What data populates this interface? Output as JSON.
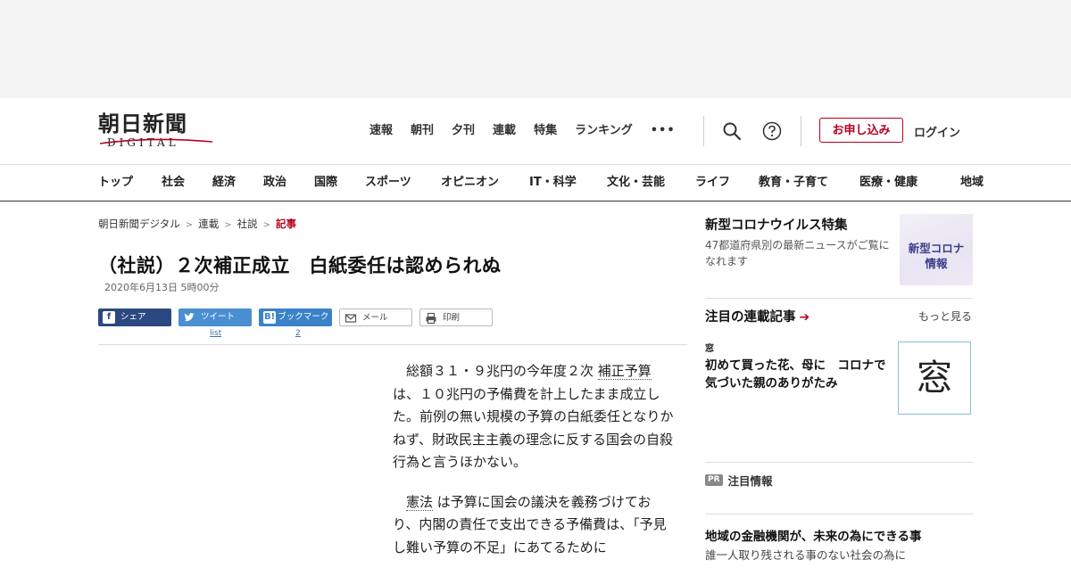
{
  "logo": {
    "main": "朝日新聞",
    "sub": "DIGITAL"
  },
  "topnav": [
    "速報",
    "朝刊",
    "夕刊",
    "連載",
    "特集",
    "ランキング"
  ],
  "more_dots": "•••",
  "header": {
    "apply": "お申し込み",
    "login": "ログイン"
  },
  "icons": {
    "search": "search-icon",
    "help": "question-circle-icon"
  },
  "catnav": [
    {
      "label": "トップ",
      "gap": 0
    },
    {
      "label": "社会"
    },
    {
      "label": "経済"
    },
    {
      "label": "政治"
    },
    {
      "label": "国際"
    },
    {
      "label": "スポーツ"
    },
    {
      "label": "オピニオン"
    },
    {
      "label": "IT・科学"
    },
    {
      "label": "文化・芸能"
    },
    {
      "label": "ライフ"
    },
    {
      "label": "教育・子育て"
    },
    {
      "label": "医療・健康"
    },
    {
      "label": "地域"
    }
  ],
  "breadcrumb": {
    "items": [
      "朝日新聞デジタル",
      "連載",
      "社説"
    ],
    "current": "記事"
  },
  "article": {
    "title": "（社説）２次補正成立　白紙委任は認められぬ",
    "date": "2020年6月13日 5時00分",
    "paragraphs": [
      {
        "pre": "総額３１・９兆円の今年度２次 ",
        "kw": "補正予算",
        "post": " は、１０兆円の予備費を計上したまま成立した。前例の無い規模の予算の白紙委任となりかねず、財政民主主義の理念に反する国会の自殺行為と言うほかない。"
      },
      {
        "pre": "",
        "kw": "憲法",
        "post": " は予算に国会の議決を義務づけており、内閣の責任で支出できる予備費は、「予見し難い予算の不足」にあてるために"
      }
    ]
  },
  "share": {
    "facebook": "シェア",
    "twitter": "ツイート",
    "hatena": "ブックマーク",
    "mail": "メール",
    "print": "印刷",
    "twitter_count": "list",
    "hatena_count": "2"
  },
  "sidebar": {
    "covid": {
      "title": "新型コロナウイルス特集",
      "desc": "47都道府県別の最新ニュースがご覧になれます",
      "thumb_line1": "新型コロナ",
      "thumb_line2": "情報"
    },
    "rensai": {
      "heading": "注目の連載記事",
      "more": "もっと見る",
      "label": "窓",
      "text": "初めて買った花、母に　コロナで気づいた親のありがたみ",
      "thumb_char": "窓"
    },
    "pr": {
      "badge": "PR",
      "label": "注目情報"
    },
    "promo": {
      "title": "地域の金融機関が、未来の為にできる事",
      "desc": "誰一人取り残される事のない社会の為に"
    }
  },
  "colors": {
    "accent": "#b8001e",
    "facebook": "#2c4880",
    "twitter": "#4a8fd1",
    "hatena": "#3a82c9"
  }
}
